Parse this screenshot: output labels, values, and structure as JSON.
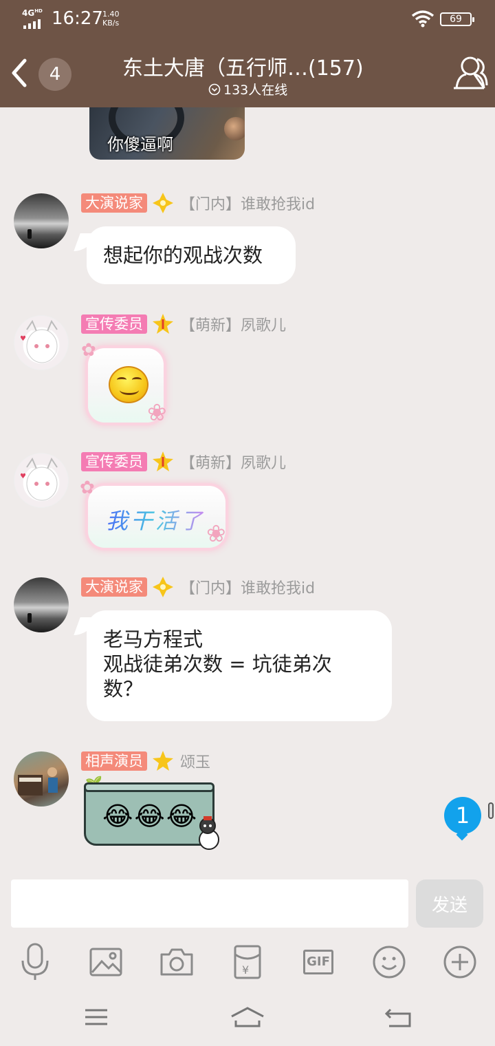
{
  "status_bar": {
    "network": "4G",
    "network_sup": "HD",
    "time": "16:27",
    "speed_value": "1.40",
    "speed_unit": "KB/s",
    "battery": "69"
  },
  "header": {
    "unread_count": "4",
    "title": "东土大唐（五行师…(157)",
    "online": "133人在线"
  },
  "messages": [
    {
      "sticker_caption": "你傻逼啊"
    },
    {
      "title": "大演说家",
      "title_color": "#f48a7a",
      "sender": "【门内】谁敢抢我id",
      "text": "想起你的观战次数"
    },
    {
      "title": "宣传委员",
      "title_color": "#f47cb3",
      "sender": "【萌新】夙歌儿"
    },
    {
      "title": "宣传委员",
      "title_color": "#f47cb3",
      "sender": "【萌新】夙歌儿",
      "sticker_text": "我干活了"
    },
    {
      "title": "大演说家",
      "title_color": "#f48a7a",
      "sender": "【门内】谁敢抢我id",
      "lines": [
        "老马方程式",
        "观战徒弟次数 = 坑徒弟次",
        "数？"
      ]
    },
    {
      "title": "相声演员",
      "title_color": "#f48a7a",
      "sender": "颂玉",
      "sticker_emojis": "😂😂😂"
    }
  ],
  "new_message_count": "1",
  "composer": {
    "input_value": "",
    "send_label": "发送"
  },
  "toolbar_icons": [
    "microphone-icon",
    "image-icon",
    "camera-icon",
    "red-packet-icon",
    "gif-icon",
    "emoji-icon",
    "plus-icon"
  ],
  "toolbar_gif_label": "GIF",
  "colors": {
    "header_bg": "#6e5446",
    "chat_bg": "#efebea",
    "badge_blue": "#12a2ec"
  }
}
